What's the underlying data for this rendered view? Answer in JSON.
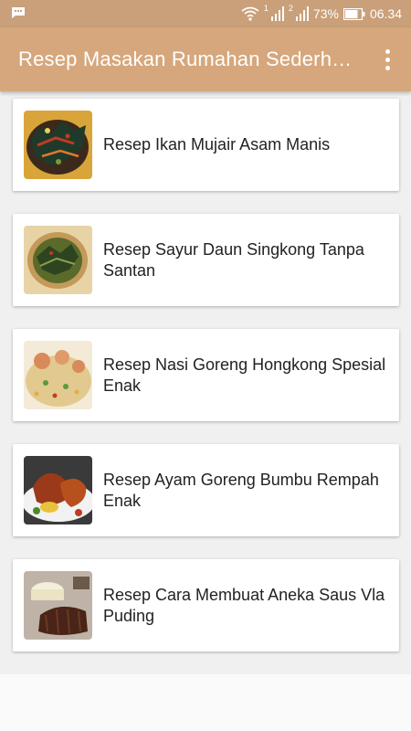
{
  "status_bar": {
    "battery_percent": "73%",
    "time": "06.34",
    "sim1": "1",
    "sim2": "2",
    "icons": [
      "message-icon",
      "wifi-icon",
      "signal-icon",
      "battery-icon"
    ]
  },
  "app_bar": {
    "title": "Resep Masakan Rumahan Sederhana",
    "menu_icon": "more-vert-icon"
  },
  "colors": {
    "status_bar": "#c9a07a",
    "app_bar": "#d6a77c",
    "background": "#f0f0f0",
    "card": "#ffffff",
    "text": "#222222"
  },
  "recipes": [
    {
      "title": "Resep Ikan Mujair Asam Manis",
      "thumbnail": "fried-fish-dish"
    },
    {
      "title": "Resep Sayur Daun Singkong Tanpa Santan",
      "thumbnail": "cassava-leaf-dish"
    },
    {
      "title": "Resep Nasi Goreng Hongkong Spesial Enak",
      "thumbnail": "fried-rice-dish"
    },
    {
      "title": "Resep Ayam Goreng Bumbu Rempah Enak",
      "thumbnail": "fried-chicken-dish"
    },
    {
      "title": "Resep Cara Membuat Aneka Saus Vla Puding",
      "thumbnail": "pudding-sauce-dish"
    }
  ]
}
